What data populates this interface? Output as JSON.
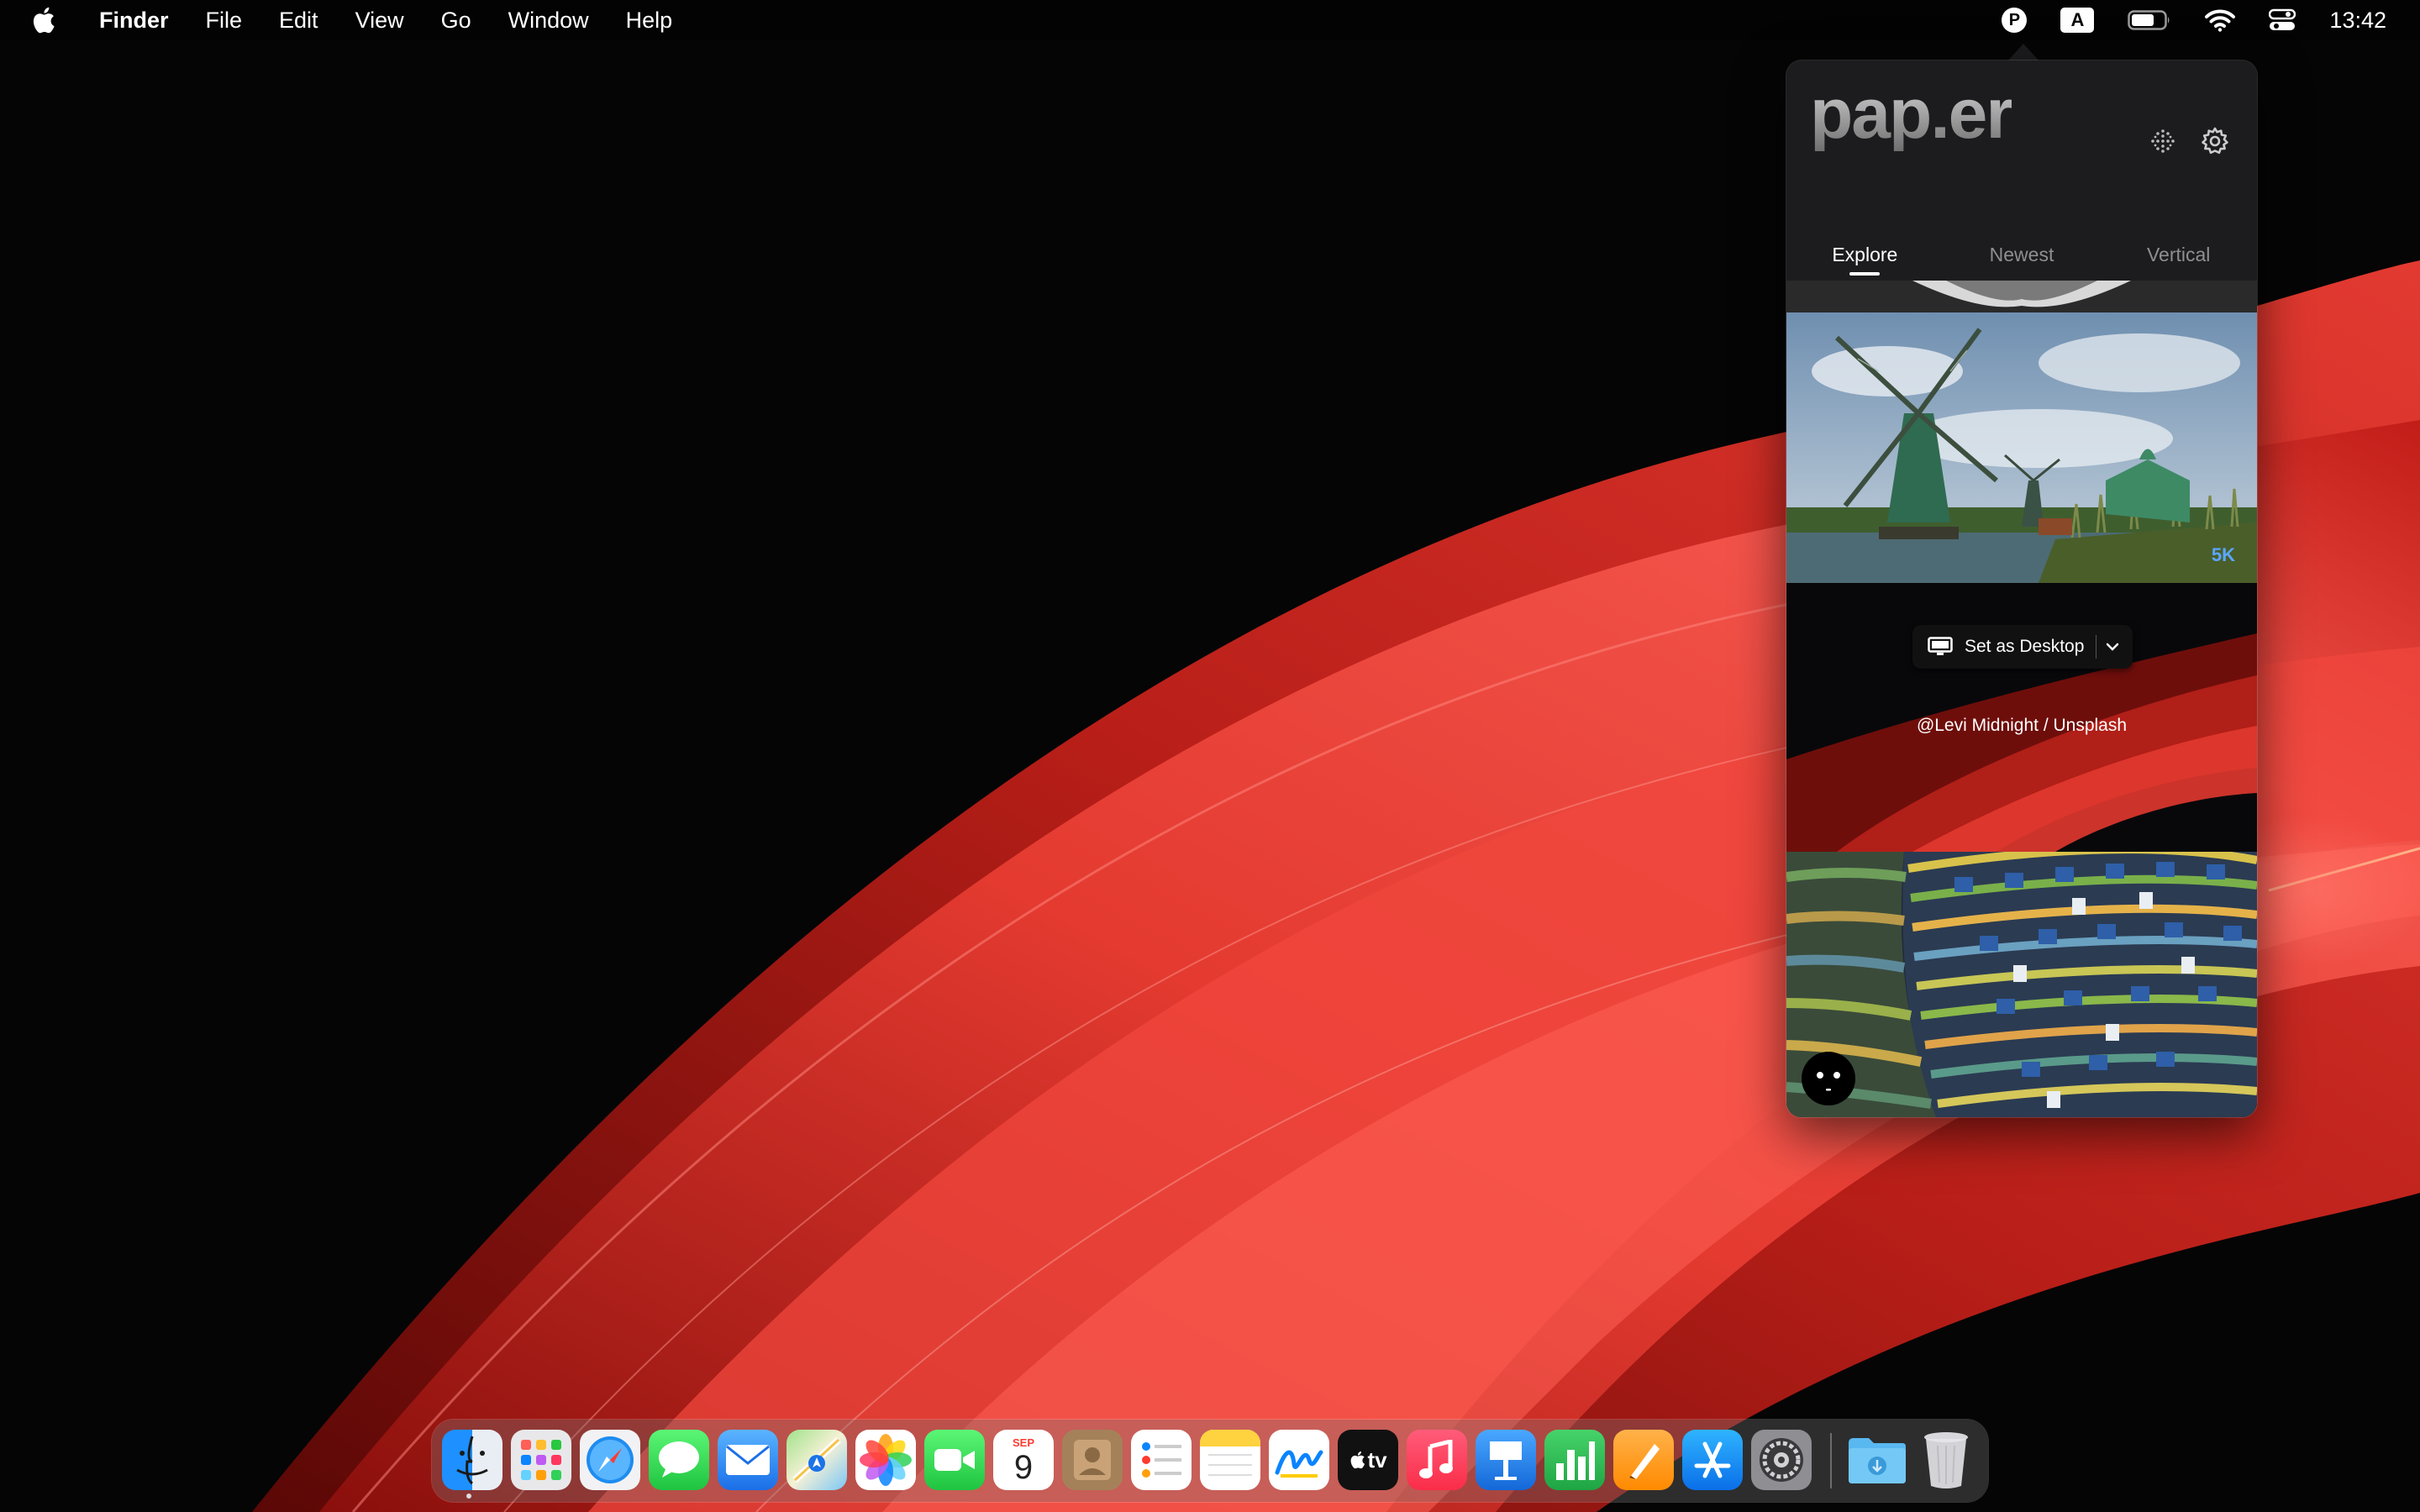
{
  "menubar": {
    "app_name": "Finder",
    "menus": [
      "File",
      "Edit",
      "View",
      "Go",
      "Window",
      "Help"
    ],
    "status": {
      "paper_icon_letter": "P",
      "input_source_letter": "A",
      "icons": [
        "paper-icon",
        "input-source-icon",
        "battery-icon",
        "wifi-icon",
        "control-center-icon"
      ],
      "clock": "13:42"
    }
  },
  "popover": {
    "logo": "pap.er",
    "header_icons": [
      "dots-grid-icon",
      "gear-icon"
    ],
    "tabs": [
      {
        "label": "Explore",
        "active": true
      },
      {
        "label": "Newest",
        "active": false
      },
      {
        "label": "Vertical",
        "active": false
      }
    ],
    "current_item": {
      "resolution": "5K",
      "set_desktop_label": "Set as Desktop",
      "credit": "@Levi Midnight / Unsplash"
    }
  },
  "dock": {
    "apps": [
      "Finder",
      "Launchpad",
      "Safari",
      "Messages",
      "Mail",
      "Maps",
      "Photos",
      "FaceTime",
      "Calendar",
      "Contacts",
      "Reminders",
      "Notes",
      "Freeform",
      "TV",
      "Music",
      "Keynote",
      "Numbers",
      "Pages",
      "App Store",
      "System Settings"
    ],
    "calendar": {
      "month": "SEP",
      "day": "9"
    },
    "tv_label": "tv",
    "extras": [
      "Downloads",
      "Trash"
    ],
    "colors": {
      "accent_blue": "#0a84ff",
      "wallpaper_red": "#e8382f"
    }
  }
}
